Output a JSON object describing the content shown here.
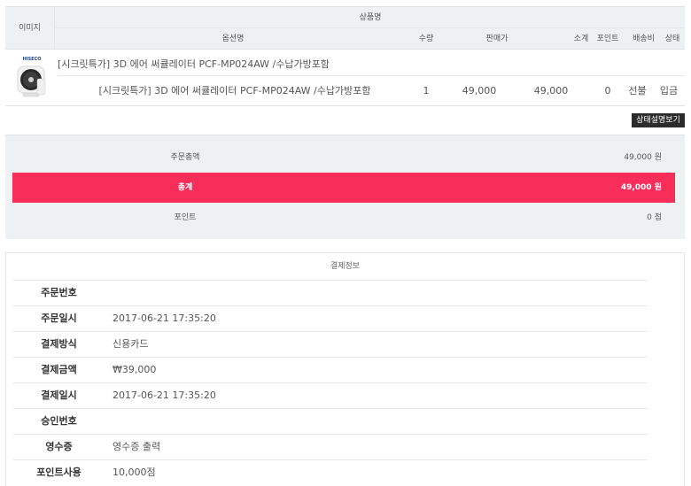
{
  "order_table": {
    "headers": {
      "image": "이미지",
      "product": "상품명",
      "option": "옵션명",
      "qty": "수량",
      "price": "판매가",
      "subtotal": "소계",
      "point": "포인트",
      "shipping": "배송비",
      "status": "상태"
    },
    "item": {
      "brand": "HISECO",
      "title": "[시크릿특가] 3D 에어 써큘레이터 PCF-MP024AW /수납가방포함",
      "option": "[시크릿특가] 3D 에어 써큘레이터 PCF-MP024AW /수납가방포함",
      "qty": "1",
      "price": "49,000",
      "subtotal": "49,000",
      "point": "0",
      "shipping": "선불",
      "status": "입금"
    }
  },
  "status_button": "상태설명보기",
  "totals": {
    "order_amount_label": "주문총액",
    "order_amount": "49,000 원",
    "grand_label": "총계",
    "grand_total": "49,000 원",
    "point_label": "포인트",
    "point_value": "0 점"
  },
  "payment": {
    "title": "결제정보",
    "rows": [
      {
        "label": "주문번호",
        "value": ""
      },
      {
        "label": "주문일시",
        "value": "2017-06-21 17:35:20"
      },
      {
        "label": "결제방식",
        "value": "신용카드"
      },
      {
        "label": "결제금액",
        "value": "₩39,000"
      },
      {
        "label": "결제일시",
        "value": "2017-06-21 17:35:20"
      },
      {
        "label": "승인번호",
        "value": ""
      },
      {
        "label": "영수증",
        "value": "영수증 출력"
      },
      {
        "label": "포인트사용",
        "value": "10,000점"
      }
    ]
  },
  "colors": {
    "header_bg": "#eef1f3",
    "grand_total_bg": "#f82d5a",
    "button_bg": "#2b2b2b"
  }
}
